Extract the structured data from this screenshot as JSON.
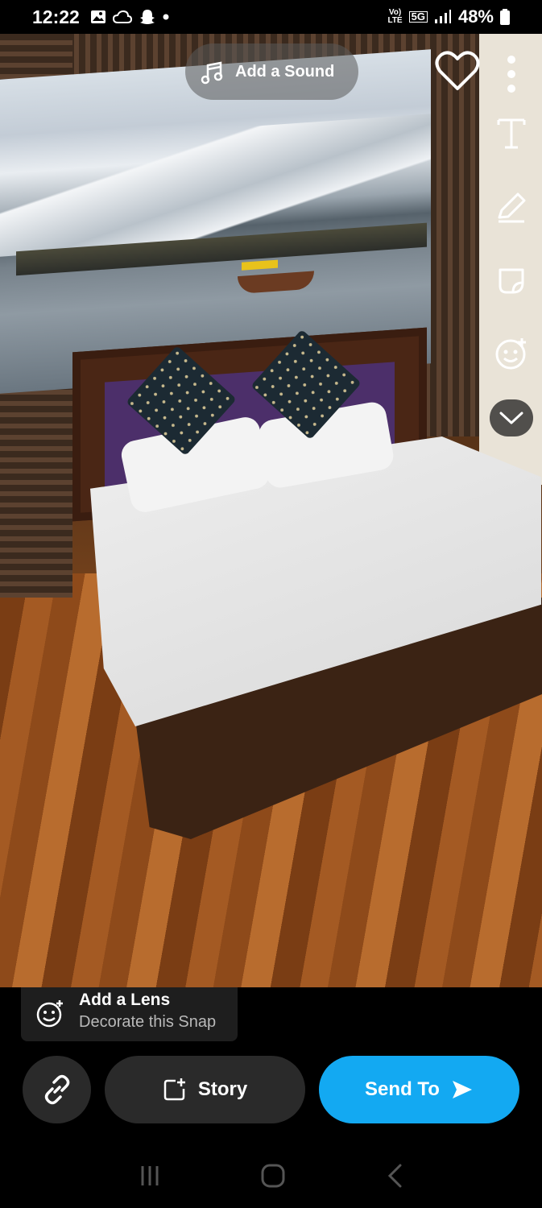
{
  "status_bar": {
    "time": "12:22",
    "network_top": "Vo)",
    "network_bottom": "LTE",
    "band": "5G",
    "battery": "48%"
  },
  "editor": {
    "add_sound_label": "Add a Sound",
    "tool_icons": [
      "text-icon",
      "pencil-icon",
      "sticker-icon",
      "lens-face-icon",
      "chevron-down-icon"
    ]
  },
  "lens": {
    "title": "Add a Lens",
    "subtitle": "Decorate this Snap"
  },
  "actions": {
    "story_label": "Story",
    "send_label": "Send To"
  },
  "colors": {
    "accent": "#13a9f2"
  }
}
